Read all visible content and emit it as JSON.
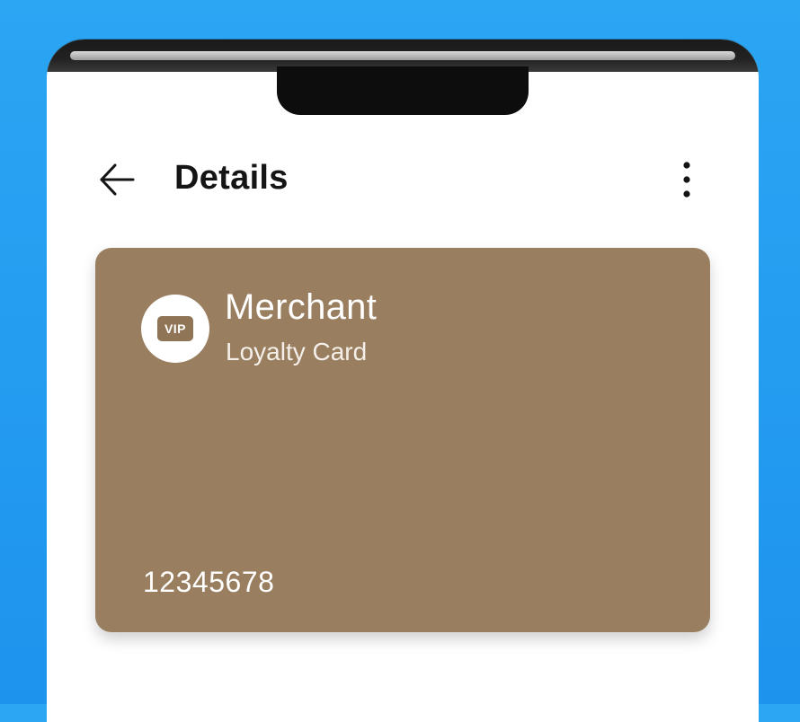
{
  "header": {
    "title": "Details",
    "back_icon": "arrow-left-icon",
    "more_icon": "more-vertical-icon"
  },
  "card": {
    "merchant": "Merchant",
    "type": "Loyalty Card",
    "logo_text": "VIP",
    "number": "12345678",
    "color": "#9a7e60"
  },
  "colors": {
    "background": "#1e93ee",
    "surface": "#ffffff",
    "text": "#151515"
  }
}
